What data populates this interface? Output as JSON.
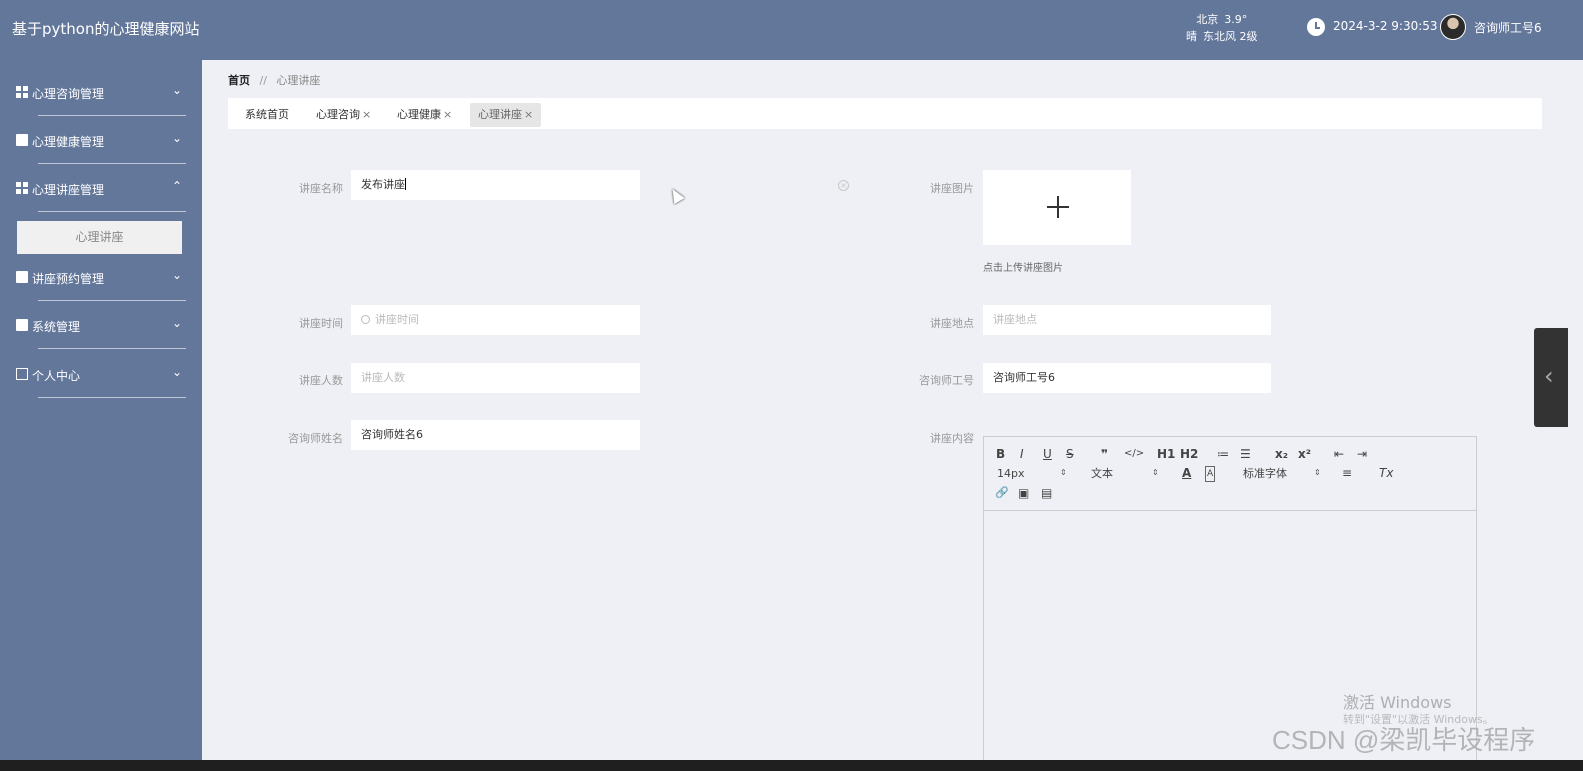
{
  "header": {
    "site_title": "基于python的心理健康网站",
    "weather_city": "北京",
    "weather_temp": "3.9°",
    "weather_cond": "晴",
    "weather_wind": "东北风 2级",
    "datetime": "2024-3-2 9:30:53",
    "user": "咨询师工号6"
  },
  "sidebar": {
    "items": [
      {
        "label": "心理咨询管理",
        "arrow": "⌄"
      },
      {
        "label": "心理健康管理",
        "arrow": "⌄"
      },
      {
        "label": "心理讲座管理",
        "arrow": "⌃"
      },
      {
        "label": "讲座预约管理",
        "arrow": "⌄"
      },
      {
        "label": "系统管理",
        "arrow": "⌄"
      },
      {
        "label": "个人中心",
        "arrow": "⌄"
      }
    ],
    "sub_item": "心理讲座"
  },
  "breadcrumb": {
    "home": "首页",
    "sep": "//",
    "current": "心理讲座"
  },
  "tabs": [
    {
      "label": "系统首页",
      "close": ""
    },
    {
      "label": "心理咨询",
      "close": "×"
    },
    {
      "label": "心理健康",
      "close": "×"
    },
    {
      "label": "心理讲座",
      "close": "×"
    }
  ],
  "form": {
    "name_label": "讲座名称",
    "name_value": "发布讲座",
    "image_label": "讲座图片",
    "image_hint": "点击上传讲座图片",
    "time_label": "讲座时间",
    "time_placeholder": "讲座时间",
    "place_label": "讲座地点",
    "place_placeholder": "讲座地点",
    "count_label": "讲座人数",
    "count_placeholder": "讲座人数",
    "counselor_no_label": "咨询师工号",
    "counselor_no_value": "咨询师工号6",
    "counselor_name_label": "咨询师姓名",
    "counselor_name_value": "咨询师姓名6",
    "content_label": "讲座内容"
  },
  "editor": {
    "bold": "B",
    "italic": "I",
    "underline": "U",
    "strike": "S",
    "quote": "❞",
    "code": "</>",
    "h1": "H1",
    "h2": "H2",
    "ol": "≔",
    "ul": "☰",
    "sub": "x₂",
    "sup": "x²",
    "outdent": "⇤",
    "indent": "⇥",
    "size": "14px",
    "block": "文本",
    "font": "标准字体",
    "color": "A",
    "bg": "A",
    "align": "≡",
    "clean": "Tx",
    "link": "🔗",
    "image": "▣",
    "video": "▤"
  },
  "watermarks": {
    "win_title": "激活 Windows",
    "win_sub": "转到\"设置\"以激活 Windows。",
    "csdn": "CSDN @梁凯毕设程序"
  }
}
